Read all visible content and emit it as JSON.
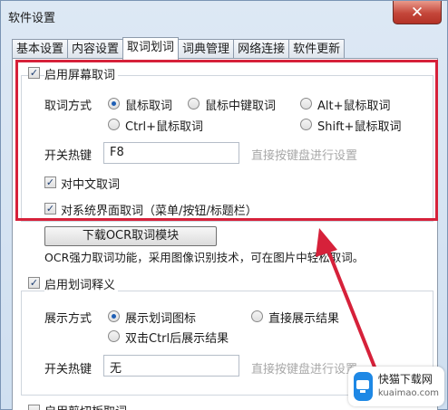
{
  "window": {
    "title": "软件设置",
    "close_glyph": "✕"
  },
  "tabs": [
    "基本设置",
    "内容设置",
    "取词划词",
    "词典管理",
    "网络连接",
    "软件更新"
  ],
  "screen_capture": {
    "enable_label": "启用屏幕取词",
    "enable_checked": true,
    "method_label": "取词方式",
    "options": [
      "鼠标取词",
      "鼠标中键取词",
      "Alt+鼠标取词",
      "Ctrl+鼠标取词",
      "Shift+鼠标取词"
    ],
    "selected_option": "鼠标取词",
    "hotkey_label": "开关热键",
    "hotkey_value": "F8",
    "hotkey_hint": "直接按键盘进行设置",
    "chinese_label": "对中文取词",
    "chinese_checked": true,
    "system_ui_label": "对系统界面取词（菜单/按钮/标题栏）",
    "system_ui_checked": true
  },
  "ocr": {
    "button_label": "下载OCR取词模块",
    "description": "OCR强力取词功能，采用图像识别技术，可在图片中轻松取词。"
  },
  "selection_translate": {
    "enable_label": "启用划词释义",
    "enable_checked": true,
    "display_label": "展示方式",
    "options": [
      "展示划词图标",
      "直接展示结果",
      "双击Ctrl后展示结果"
    ],
    "selected_option": "展示划词图标",
    "hotkey_label": "开关热键",
    "hotkey_value": "无",
    "hotkey_hint": "直接按键盘进行设置"
  },
  "clipboard": {
    "enable_label": "启用剪切板取词"
  },
  "annotation": {
    "highlight_color": "#d6213a"
  },
  "watermark": {
    "name": "快猫下载网",
    "url": "kuaimao.com"
  },
  "colors": {
    "accent": "#1f5fb5",
    "window_bg": "#cfdff0",
    "highlight": "#d6213a"
  }
}
